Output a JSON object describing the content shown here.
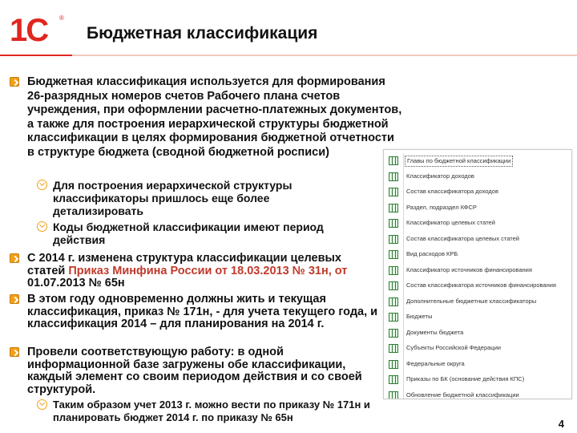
{
  "slide": {
    "logo": "1С",
    "logo_reg": "®",
    "title": "Бюджетная классификация",
    "page_number": "4"
  },
  "content": {
    "p1": "Бюджетная классификация используется для формирования 26-разрядных номеров счетов Рабочего плана счетов учреждения, при оформлении расчетно-платежных документов, а также для построения иерархической структуры бюджетной классификации в целях формирования бюджетной отчетности в структуре бюджета (сводной бюджетной росписи)",
    "s1": "Для построения иерархической структуры классификаторы пришлось еще более детализировать",
    "s2": "Коды бюджетной классификации имеют период действия",
    "p2_prefix": "С 2014 г. изменена структура классификации целевых статей ",
    "p2_highlight": "Приказ Минфина России от 18.03.2013 № 31н, от",
    "p2_suffix": " 01.07.2013 № 65н",
    "p3": "В этом году одновременно должны жить и текущая классификация, приказ № 171н, - для учета текущего года, и классификация 2014 – для планирования на 2014 г.",
    "p4": "Провели соответствующую работу: в одной информационной базе загружены обе классификации, каждый элемент со своим периодом действия и со своей структурой.",
    "s3": "Таким образом учет 2013 г. можно вести по приказу № 171н и планировать бюджет 2014 г. по приказу № 65н"
  },
  "panel": {
    "items": [
      {
        "label": "Главы по бюджетной классификации"
      },
      {
        "label": "Классификатор доходов"
      },
      {
        "label": "Состав классификатора доходов"
      },
      {
        "label": "Раздел, подраздел КФСР"
      },
      {
        "label": "Классификатор целевых статей"
      },
      {
        "label": "Состав классификатора целевых статей"
      },
      {
        "label": "Вид расходов КРБ"
      },
      {
        "label": "Классификатор источников финансирования"
      },
      {
        "label": "Состав классификатора источников финансирования"
      },
      {
        "label": "Дополнительные бюджетные классификаторы"
      },
      {
        "label": "Бюджеты"
      },
      {
        "label": "Документы бюджета"
      },
      {
        "label": "Субъекты Российской Федерации"
      },
      {
        "label": "Федеральные округа"
      },
      {
        "label": "Приказы по БК (основание действия КПС)"
      },
      {
        "label": "Обновление бюджетной классификации"
      }
    ]
  }
}
